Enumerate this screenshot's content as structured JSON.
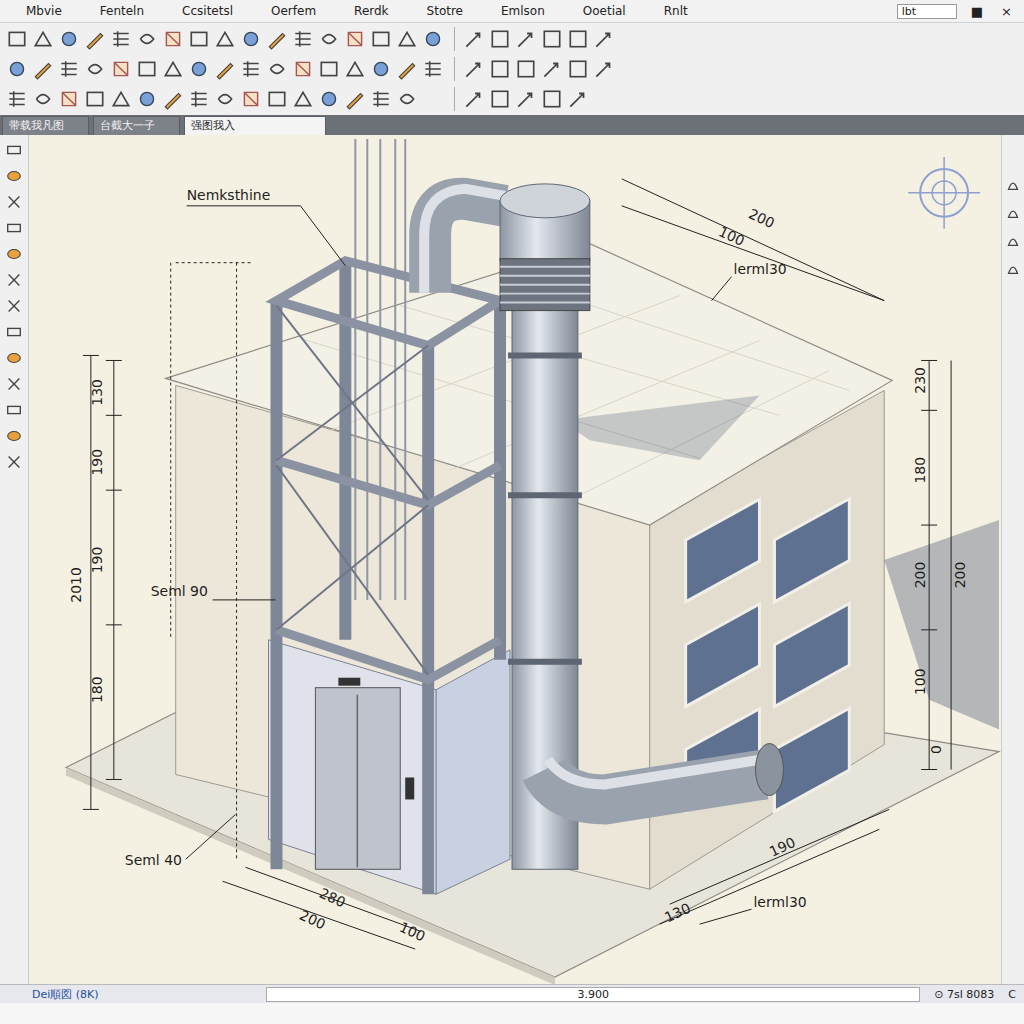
{
  "window": {
    "field": "lbt",
    "restore": "■",
    "close": "×"
  },
  "menu": [
    "Mbvie",
    "Fenteln",
    "Ccsitetsl",
    "Oerfem",
    "Rerdk",
    "Stotre",
    "Emlson",
    "Ooetial",
    "Rnlt"
  ],
  "tabs": [
    {
      "label": "带载我凡图",
      "selected": false
    },
    {
      "label": "台截大一子",
      "selected": false
    },
    {
      "label": "强图我入",
      "selected": true
    }
  ],
  "drawing": {
    "labels": [
      "Nemksthine",
      "lerml30",
      "Seml 90",
      "Seml 40",
      "lerml30"
    ],
    "dimensions": [
      "200",
      "100",
      "130",
      "190",
      "190",
      "180",
      "2010",
      "230",
      "180",
      "200",
      "100",
      "0",
      "200",
      "280",
      "200",
      "100",
      "190",
      "130"
    ]
  },
  "status_bar": {
    "left": "Dei順図 (8K)",
    "center": "3.900",
    "right": "⊙ 7sl 8083",
    "end": "C"
  }
}
